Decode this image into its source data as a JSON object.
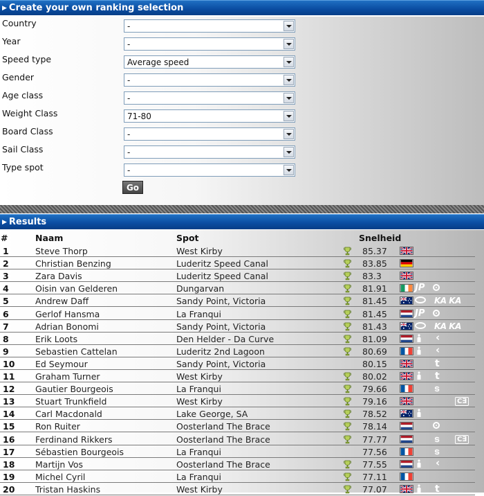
{
  "filter": {
    "title": "Create your own ranking selection",
    "fields": [
      {
        "label": "Country",
        "value": "-"
      },
      {
        "label": "Year",
        "value": "-"
      },
      {
        "label": "Speed type",
        "value": "Average speed"
      },
      {
        "label": "Gender",
        "value": "-"
      },
      {
        "label": "Age class",
        "value": "-"
      },
      {
        "label": "Weight Class",
        "value": "71-80"
      },
      {
        "label": "Board Class",
        "value": "-"
      },
      {
        "label": "Sail Class",
        "value": "-"
      },
      {
        "label": "Type spot",
        "value": "-"
      }
    ],
    "go_label": "Go"
  },
  "results": {
    "title": "Results",
    "headers": {
      "rank": "#",
      "name": "Naam",
      "spot": "Spot",
      "speed": "Snelheid"
    },
    "rows": [
      {
        "rank": "1",
        "name": "Steve Thorp",
        "spot": "West Kirby",
        "speed": "85.37",
        "trophy": true,
        "flag": "gb",
        "brands": []
      },
      {
        "rank": "2",
        "name": "Christian Benzing",
        "spot": "Luderitz Speed Canal",
        "speed": "83.85",
        "trophy": true,
        "flag": "de",
        "brands": []
      },
      {
        "rank": "3",
        "name": "Zara Davis",
        "spot": "Luderitz Speed Canal",
        "speed": "83.3",
        "trophy": true,
        "flag": "gb",
        "brands": []
      },
      {
        "rank": "4",
        "name": "Oisin van Gelderen",
        "spot": "Dungarvan",
        "speed": "81.91",
        "trophy": true,
        "flag": "ie",
        "brands": [
          "jp-logo",
          "target-logo"
        ]
      },
      {
        "rank": "5",
        "name": "Andrew Daff",
        "spot": "Sandy Point, Victoria",
        "speed": "81.45",
        "trophy": true,
        "flag": "au",
        "brands": [
          "oval-logo",
          "kaka-logo"
        ]
      },
      {
        "rank": "6",
        "name": "Gerlof Hansma",
        "spot": "La Franqui",
        "speed": "81.45",
        "trophy": true,
        "flag": "nl",
        "brands": [
          "jp-logo",
          "target-logo"
        ]
      },
      {
        "rank": "7",
        "name": "Adrian Bonomi",
        "spot": "Sandy Point, Victoria",
        "speed": "81.43",
        "trophy": true,
        "flag": "au",
        "brands": [
          "oval-logo",
          "kaka-logo"
        ]
      },
      {
        "rank": "8",
        "name": "Erik Loots",
        "spot": "Den Helder - Da Curve",
        "speed": "81.09",
        "trophy": true,
        "flag": "nl",
        "brands": [
          "figure-logo",
          "chevron-logo"
        ]
      },
      {
        "rank": "9",
        "name": "Sebastien Cattelan",
        "spot": "Luderitz 2nd Lagoon",
        "speed": "80.69",
        "trophy": true,
        "flag": "fr",
        "brands": [
          "figure-logo",
          "chevron-logo"
        ]
      },
      {
        "rank": "10",
        "name": "Ed Seymour",
        "spot": "Sandy Point, Victoria",
        "speed": "80.15",
        "trophy": false,
        "flag": "gb",
        "brands": [
          "t-logo"
        ]
      },
      {
        "rank": "11",
        "name": "Graham Turner",
        "spot": "West Kirby",
        "speed": "80.02",
        "trophy": true,
        "flag": "gb",
        "brands": [
          "figure-logo",
          "t-logo"
        ]
      },
      {
        "rank": "12",
        "name": "Gautier Bourgeois",
        "spot": "La Franqui",
        "speed": "79.66",
        "trophy": true,
        "flag": "fr",
        "brands": [
          "swirl-logo"
        ]
      },
      {
        "rank": "13",
        "name": "Stuart Trunkfield",
        "spot": "West Kirby",
        "speed": "79.16",
        "trophy": true,
        "flag": "gb",
        "brands": [
          "ce-logo"
        ]
      },
      {
        "rank": "14",
        "name": "Carl Macdonald",
        "spot": "Lake George, SA",
        "speed": "78.52",
        "trophy": true,
        "flag": "au",
        "brands": [
          "figure-logo"
        ]
      },
      {
        "rank": "15",
        "name": "Ron Ruiter",
        "spot": "Oosterland The Brace",
        "speed": "78.14",
        "trophy": true,
        "flag": "nl",
        "brands": [
          "target-logo"
        ]
      },
      {
        "rank": "16",
        "name": "Ferdinand Rikkers",
        "spot": "Oosterland The Brace",
        "speed": "77.77",
        "trophy": true,
        "flag": "nl",
        "brands": [
          "swirl-logo",
          "ce-logo"
        ]
      },
      {
        "rank": "17",
        "name": "Sébastien Bourgeois",
        "spot": "La Franqui",
        "speed": "77.56",
        "trophy": false,
        "flag": "fr",
        "brands": [
          "swirl-logo"
        ]
      },
      {
        "rank": "18",
        "name": "Martijn Vos",
        "spot": "Oosterland The Brace",
        "speed": "77.55",
        "trophy": true,
        "flag": "nl",
        "brands": [
          "figure-logo",
          "chevron-logo"
        ]
      },
      {
        "rank": "19",
        "name": "Michel Cyril",
        "spot": "La Franqui",
        "speed": "77.11",
        "trophy": true,
        "flag": "fr",
        "brands": []
      },
      {
        "rank": "20",
        "name": "Tristan Haskins",
        "spot": "West Kirby",
        "speed": "77.07",
        "trophy": true,
        "flag": "gb",
        "brands": [
          "figure-logo",
          "t-logo"
        ]
      }
    ]
  },
  "brand_text": {
    "jp": "JP",
    "kaka": "KA KA",
    "t": "t",
    "chevron": "‹",
    "swirl": "ട",
    "ce": "C∃"
  }
}
